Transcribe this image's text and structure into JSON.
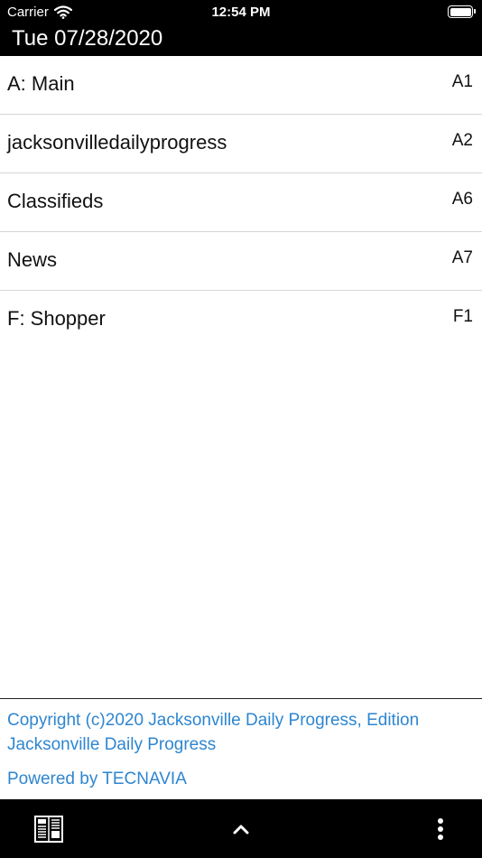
{
  "status_bar": {
    "carrier": "Carrier",
    "time": "12:54 PM",
    "battery_level": 1.0
  },
  "header": {
    "title": "Tue 07/28/2020"
  },
  "sections": [
    {
      "name": "A: Main",
      "page": "A1"
    },
    {
      "name": "jacksonvilledailyprogress",
      "page": "A2"
    },
    {
      "name": "Classifieds",
      "page": "A6"
    },
    {
      "name": "News",
      "page": "A7"
    },
    {
      "name": "F: Shopper",
      "page": "F1"
    }
  ],
  "footer": {
    "copyright": "Copyright (c)2020 Jacksonville Daily Progress, Edition Jacksonville Daily Progress",
    "powered_by": "Powered by TECNAVIA"
  },
  "toolbar": {
    "icons": [
      "newspaper-pages-icon",
      "chevron-up-icon",
      "more-vertical-icon"
    ]
  },
  "colors": {
    "bar_background": "#000000",
    "link": "#2e86d0",
    "divider": "#d6d6d6"
  }
}
